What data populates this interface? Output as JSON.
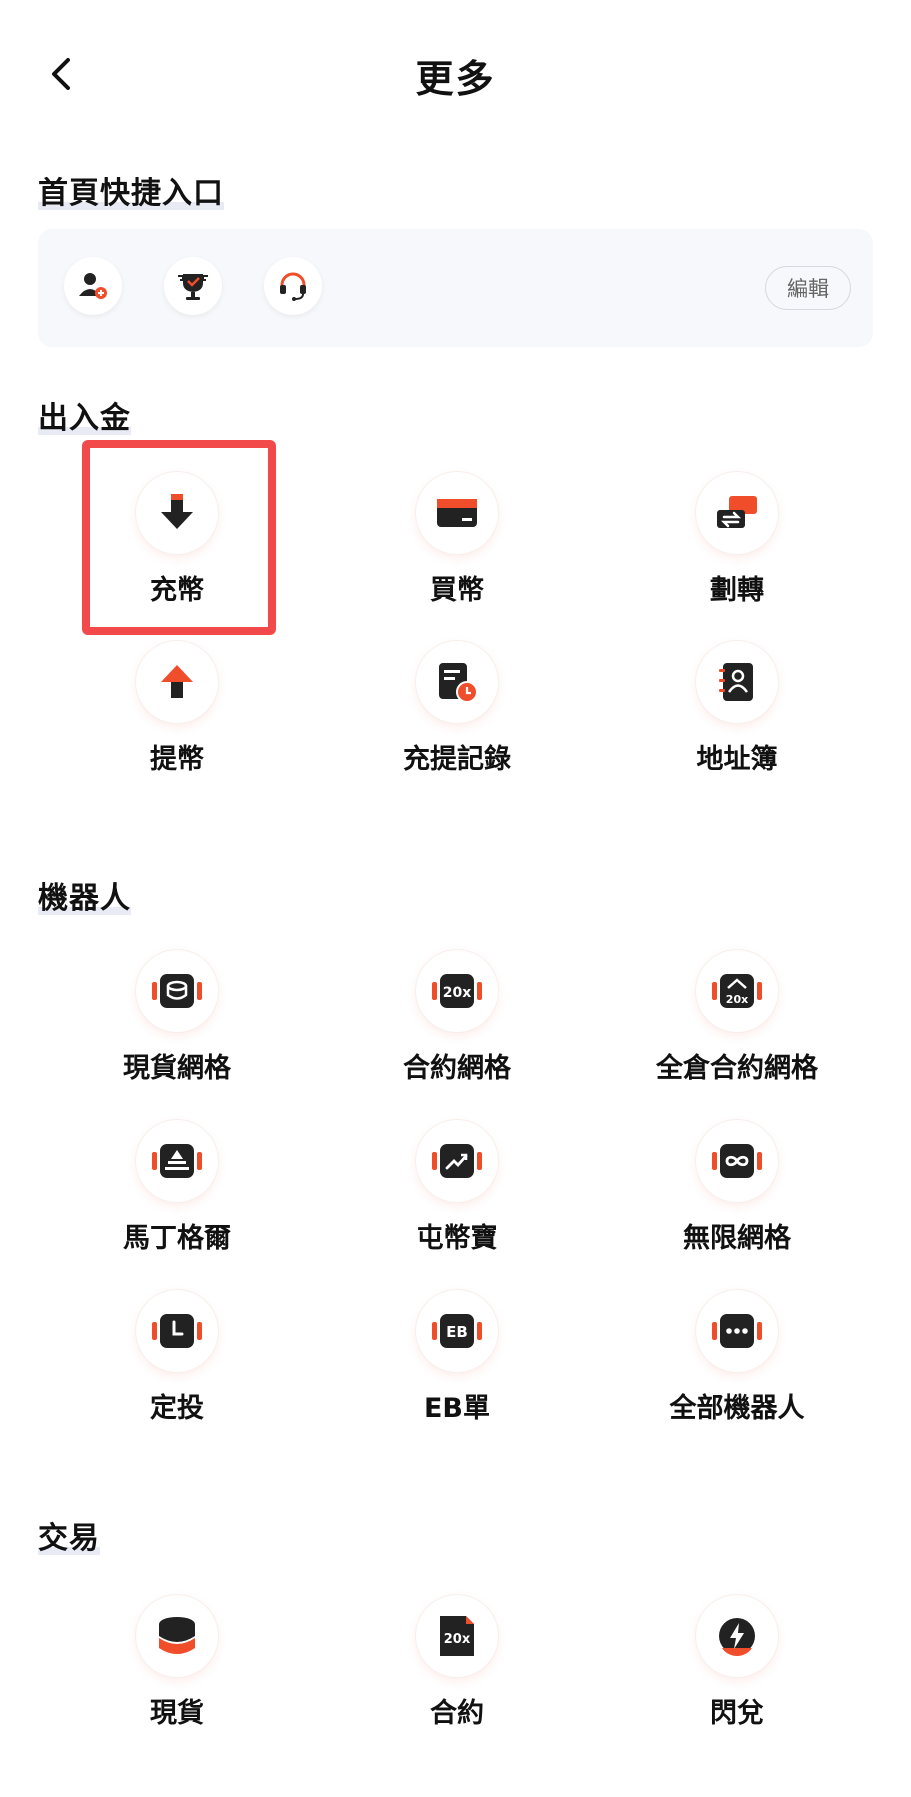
{
  "header": {
    "title": "更多"
  },
  "sections": {
    "quick": {
      "title": "首頁快捷入口",
      "edit_label": "編輯"
    },
    "deposit": {
      "title": "出入金",
      "items": [
        {
          "label": "充幣",
          "icon": "arrow-down-icon"
        },
        {
          "label": "買幣",
          "icon": "card-icon"
        },
        {
          "label": "劃轉",
          "icon": "transfer-icon"
        },
        {
          "label": "提幣",
          "icon": "arrow-up-icon"
        },
        {
          "label": "充提記錄",
          "icon": "record-clock-icon"
        },
        {
          "label": "地址簿",
          "icon": "address-book-icon"
        }
      ]
    },
    "bots": {
      "title": "機器人",
      "items": [
        {
          "label": "現貨網格",
          "icon": "spot-grid-icon"
        },
        {
          "label": "合約網格",
          "icon": "futures-grid-icon",
          "badge": "20x"
        },
        {
          "label": "全倉合約網格",
          "icon": "cross-futures-grid-icon",
          "badge": "20x"
        },
        {
          "label": "馬丁格爾",
          "icon": "martingale-icon"
        },
        {
          "label": "屯幣寶",
          "icon": "trend-icon"
        },
        {
          "label": "無限網格",
          "icon": "infinity-icon"
        },
        {
          "label": "定投",
          "icon": "clock-icon"
        },
        {
          "label": "EB單",
          "icon": "eb-icon",
          "badge": "EB"
        },
        {
          "label": "全部機器人",
          "icon": "more-dots-icon"
        }
      ]
    },
    "trade": {
      "title": "交易",
      "items": [
        {
          "label": "現貨",
          "icon": "coin-stack-icon"
        },
        {
          "label": "合約",
          "icon": "futures-icon",
          "badge": "20x"
        },
        {
          "label": "閃兌",
          "icon": "flash-icon"
        }
      ]
    }
  },
  "colors": {
    "accent": "#f04e2a",
    "dark": "#222222",
    "highlight": "#f24a4a"
  }
}
